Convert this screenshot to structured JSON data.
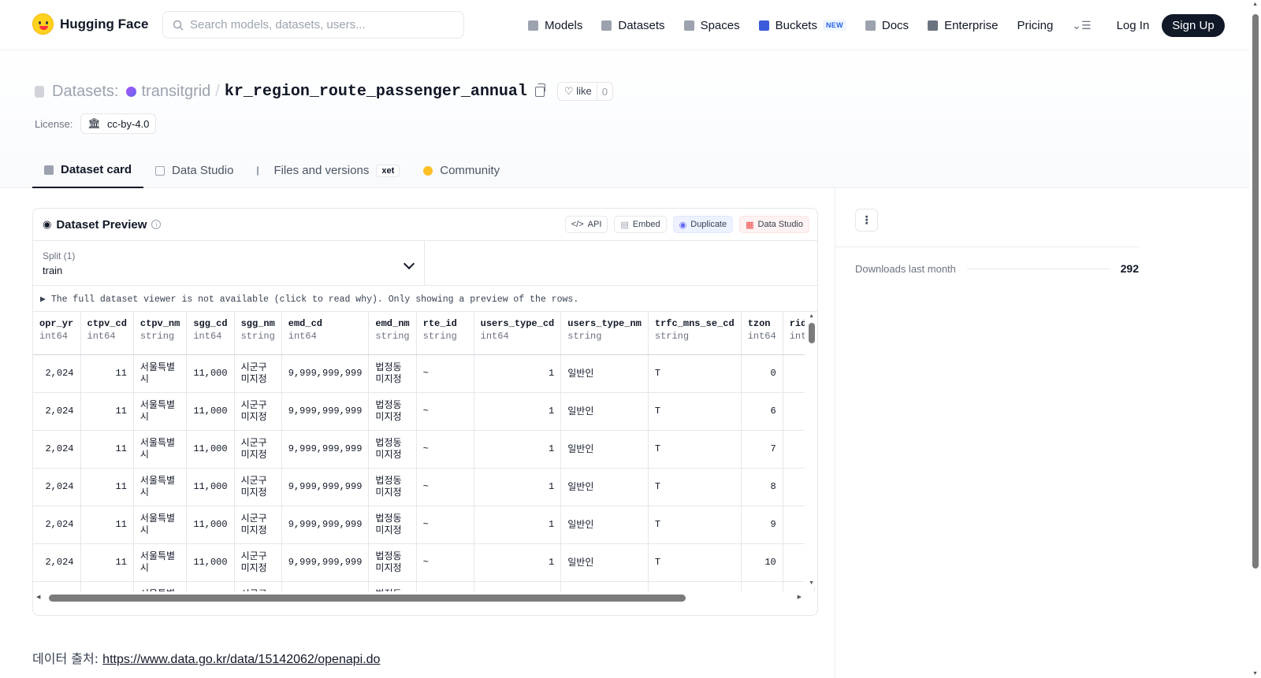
{
  "nav": {
    "brand": "Hugging Face",
    "search_placeholder": "Search models, datasets, users...",
    "items": [
      "Models",
      "Datasets",
      "Spaces",
      "Buckets",
      "Docs",
      "Enterprise",
      "Pricing"
    ],
    "buckets_badge": "NEW",
    "login": "Log In",
    "signup": "Sign Up"
  },
  "repo": {
    "kind": "Datasets:",
    "org": "transitgrid",
    "name": "kr_region_route_passenger_annual",
    "like_label": "like",
    "like_count": "0",
    "license_label": "License:",
    "license": "cc-by-4.0"
  },
  "tabs": [
    "Dataset card",
    "Data Studio",
    "Files and versions",
    "Community"
  ],
  "xet_badge": "xet",
  "preview": {
    "title": "Dataset Preview",
    "actions": [
      "API",
      "Embed",
      "Duplicate",
      "Data Studio"
    ],
    "split_label": "Split (1)",
    "split_value": "train",
    "notice": "▶ The full dataset viewer is not available (click to read why). Only showing a preview of the rows.",
    "columns": [
      {
        "name": "opr_yr",
        "type": "int64"
      },
      {
        "name": "ctpv_cd",
        "type": "int64"
      },
      {
        "name": "ctpv_nm",
        "type": "string"
      },
      {
        "name": "sgg_cd",
        "type": "int64"
      },
      {
        "name": "sgg_nm",
        "type": "string"
      },
      {
        "name": "emd_cd",
        "type": "int64"
      },
      {
        "name": "emd_nm",
        "type": "string"
      },
      {
        "name": "rte_id",
        "type": "string"
      },
      {
        "name": "users_type_cd",
        "type": "int64"
      },
      {
        "name": "users_type_nm",
        "type": "string"
      },
      {
        "name": "trfc_mns_se_cd",
        "type": "string"
      },
      {
        "name": "tzon",
        "type": "int64"
      },
      {
        "name": "rid",
        "type": "int"
      }
    ],
    "rows": [
      [
        "2,024",
        "11",
        "서울특별시",
        "11,000",
        "시군구미지정",
        "9,999,999,999",
        "법정동미지정",
        "~",
        "1",
        "일반인",
        "T",
        "0",
        ""
      ],
      [
        "2,024",
        "11",
        "서울특별시",
        "11,000",
        "시군구미지정",
        "9,999,999,999",
        "법정동미지정",
        "~",
        "1",
        "일반인",
        "T",
        "6",
        ""
      ],
      [
        "2,024",
        "11",
        "서울특별시",
        "11,000",
        "시군구미지정",
        "9,999,999,999",
        "법정동미지정",
        "~",
        "1",
        "일반인",
        "T",
        "7",
        ""
      ],
      [
        "2,024",
        "11",
        "서울특별시",
        "11,000",
        "시군구미지정",
        "9,999,999,999",
        "법정동미지정",
        "~",
        "1",
        "일반인",
        "T",
        "8",
        ""
      ],
      [
        "2,024",
        "11",
        "서울특별시",
        "11,000",
        "시군구미지정",
        "9,999,999,999",
        "법정동미지정",
        "~",
        "1",
        "일반인",
        "T",
        "9",
        ""
      ],
      [
        "2,024",
        "11",
        "서울특별시",
        "11,000",
        "시군구미지정",
        "9,999,999,999",
        "법정동미지정",
        "~",
        "1",
        "일반인",
        "T",
        "10",
        ""
      ],
      [
        "",
        "",
        "서울특별시",
        "",
        "시군구미지정",
        "",
        "법정동미지정",
        "",
        "",
        "",
        "",
        "",
        ""
      ]
    ]
  },
  "source": {
    "label": "데이터 출처:",
    "url": "https://www.data.go.kr/data/15142062/openapi.do"
  },
  "sidebar": {
    "downloads_label": "Downloads last month",
    "downloads_value": "292"
  }
}
